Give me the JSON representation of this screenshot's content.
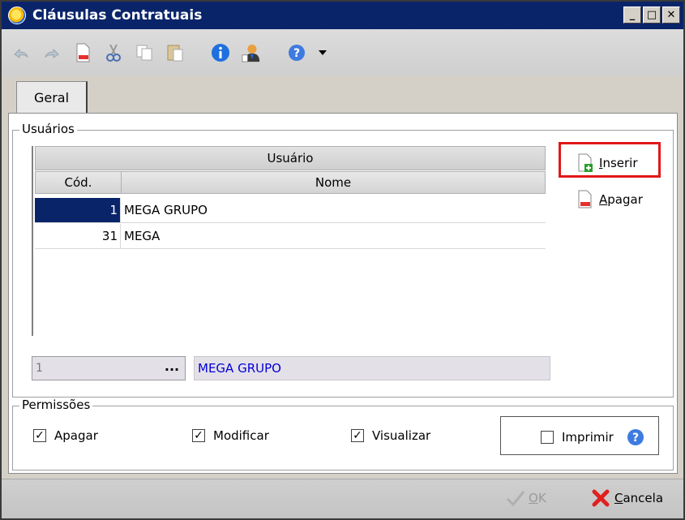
{
  "window": {
    "title": "Cláusulas Contratuais",
    "controls": [
      "_",
      "□",
      "✕"
    ]
  },
  "toolbar": {
    "icons": [
      "undo-icon",
      "redo-icon",
      "new-document-icon",
      "cut-icon",
      "copy-icon",
      "paste-icon",
      "info-icon",
      "user-icon",
      "help-icon",
      "dropdown-arrow-icon"
    ]
  },
  "tabs": [
    {
      "label": "Geral",
      "active": true
    }
  ],
  "usuarios": {
    "group_label": "Usuários",
    "grid": {
      "band_header": "Usuário",
      "columns": [
        "Cód.",
        "Nome"
      ],
      "rows": [
        {
          "cod": "1",
          "nome": "MEGA GRUPO",
          "selected": true
        },
        {
          "cod": "31",
          "nome": "MEGA",
          "selected": false
        }
      ]
    },
    "lookup": {
      "code_value": "1",
      "button_label": "...",
      "name_value": "MEGA GRUPO"
    },
    "buttons": {
      "inserir": "Inserir",
      "apagar": "Apagar"
    }
  },
  "permissoes": {
    "group_label": "Permissões",
    "items": [
      {
        "label": "Apagar",
        "checked": true
      },
      {
        "label": "Modificar",
        "checked": true
      },
      {
        "label": "Visualizar",
        "checked": true
      },
      {
        "label": "Imprimir",
        "checked": false
      }
    ]
  },
  "footer": {
    "ok_label": "OK",
    "cancel_label": "Cancela"
  },
  "colors": {
    "titlebar": "#0a246a",
    "selection": "#0a246a",
    "highlight": "#e01818",
    "lookup_text": "#0000d8"
  }
}
